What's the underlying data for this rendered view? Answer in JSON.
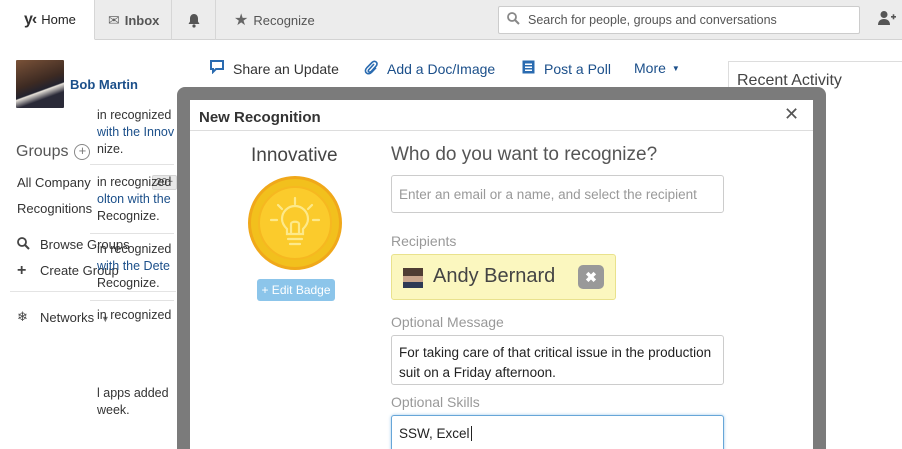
{
  "nav": {
    "home_logo": "y‹",
    "home_label": "Home",
    "inbox_label": "Inbox",
    "recognize_label": "Recognize",
    "search_placeholder": "Search for people, groups and conversations"
  },
  "sidebar": {
    "user_name": "Bob Martin",
    "groups_heading": "Groups",
    "groups": [
      {
        "label": "All Company",
        "badge": "20+"
      },
      {
        "label": "Recognitions"
      }
    ],
    "browse_groups": "Browse Groups",
    "create_group": "Create Group",
    "networks": "Networks"
  },
  "publisher": {
    "share": "Share an Update",
    "doc": "Add a Doc/Image",
    "poll": "Post a Poll",
    "more": "More"
  },
  "activity": {
    "title": "Recent Activity",
    "items": [
      [
        "in recognized",
        "with the Innov",
        "nize."
      ],
      [
        "in recognized",
        "olton with the",
        "Recognize."
      ],
      [
        "in recognized",
        "with the Dete",
        "Recognize."
      ],
      [
        "in recognized"
      ]
    ],
    "section2_partial": "y",
    "section2_lines": [
      "l apps added",
      "week."
    ]
  },
  "modal": {
    "title": "New Recognition",
    "badge_name": "Innovative",
    "edit_badge": "+ Edit Badge",
    "question": "Who do you want to recognize?",
    "recipient_placeholder": "Enter an email or a name, and select the recipient",
    "recipients_label": "Recipients",
    "recipient_name": "Andy Bernard",
    "message_label": "Optional Message",
    "message_value": "For taking care of that critical issue in the production suit on a Friday afternoon.",
    "skills_label": "Optional Skills",
    "skills_value": "SSW, Excel"
  },
  "colors": {
    "link": "#1b4f8a",
    "badge_gold": "#f2c01d",
    "edit_badge_bg": "#8cc5ea",
    "chip_bg": "#fbf7bf"
  }
}
